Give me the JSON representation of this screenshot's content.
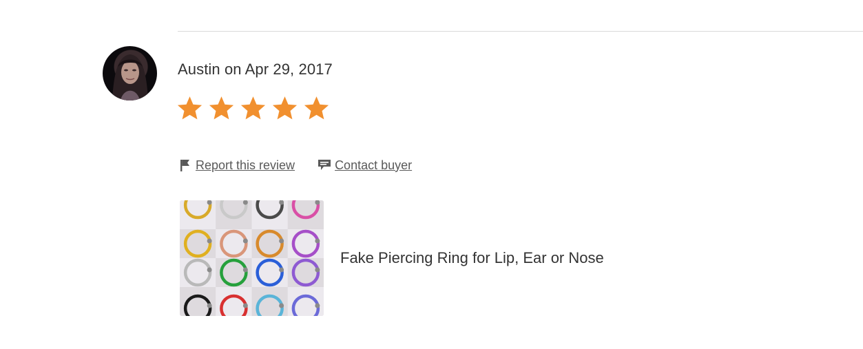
{
  "review": {
    "reviewer_name": "Austin",
    "date_text": "on Apr 29, 2017",
    "rating": 5,
    "rating_max": 5
  },
  "actions": {
    "report_label": "Report this review",
    "report_icon": "flag-icon",
    "contact_label": "Contact buyer",
    "contact_icon": "message-icon"
  },
  "listing": {
    "title": "Fake Piercing Ring for Lip, Ear or Nose",
    "thumbnail_alt": "listing-thumbnail"
  },
  "colors": {
    "star": "#f1902f",
    "link": "#595959",
    "divider": "#d9d9d9"
  }
}
